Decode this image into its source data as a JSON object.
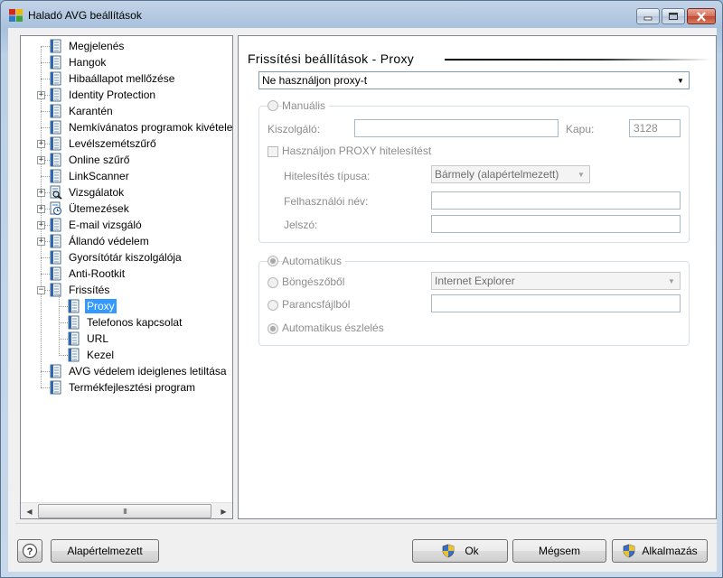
{
  "window": {
    "title": "Haladó AVG beállítások"
  },
  "tree": {
    "items": [
      {
        "label": "Megjelenés",
        "expandable": false,
        "level": 0,
        "icon": "settings-page-icon"
      },
      {
        "label": "Hangok",
        "expandable": false,
        "level": 0,
        "icon": "settings-page-icon"
      },
      {
        "label": "Hibaállapot mellőzése",
        "expandable": false,
        "level": 0,
        "icon": "settings-page-icon"
      },
      {
        "label": "Identity Protection",
        "expandable": true,
        "level": 0,
        "icon": "settings-page-icon"
      },
      {
        "label": "Karantén",
        "expandable": false,
        "level": 0,
        "icon": "settings-page-icon"
      },
      {
        "label": "Nemkívánatos programok kivételei",
        "expandable": false,
        "level": 0,
        "icon": "settings-page-icon"
      },
      {
        "label": "Levélszemétszűrő",
        "expandable": true,
        "level": 0,
        "icon": "settings-page-icon"
      },
      {
        "label": "Online szűrő",
        "expandable": true,
        "level": 0,
        "icon": "settings-page-icon"
      },
      {
        "label": "LinkScanner",
        "expandable": false,
        "level": 0,
        "icon": "settings-page-icon"
      },
      {
        "label": "Vizsgálatok",
        "expandable": true,
        "level": 0,
        "icon": "scan-magnifier-icon"
      },
      {
        "label": "Ütemezések",
        "expandable": true,
        "level": 0,
        "icon": "schedule-clock-icon"
      },
      {
        "label": "E-mail vizsgáló",
        "expandable": true,
        "level": 0,
        "icon": "settings-page-icon"
      },
      {
        "label": "Állandó védelem",
        "expandable": true,
        "level": 0,
        "icon": "settings-page-icon"
      },
      {
        "label": "Gyorsítótár kiszolgálója",
        "expandable": false,
        "level": 0,
        "icon": "settings-page-icon"
      },
      {
        "label": "Anti-Rootkit",
        "expandable": false,
        "level": 0,
        "icon": "settings-page-icon"
      },
      {
        "label": "Frissítés",
        "expandable": true,
        "expanded": true,
        "level": 0,
        "icon": "settings-page-icon"
      },
      {
        "label": "Proxy",
        "expandable": false,
        "level": 1,
        "icon": "settings-page-icon",
        "selected": true
      },
      {
        "label": "Telefonos kapcsolat",
        "expandable": false,
        "level": 1,
        "icon": "settings-page-icon"
      },
      {
        "label": "URL",
        "expandable": false,
        "level": 1,
        "icon": "settings-page-icon"
      },
      {
        "label": "Kezel",
        "expandable": false,
        "level": 1,
        "icon": "settings-page-icon"
      },
      {
        "label": "AVG védelem ideiglenes letiltása",
        "expandable": false,
        "level": 0,
        "icon": "settings-page-icon"
      },
      {
        "label": "Termékfejlesztési program",
        "expandable": false,
        "level": 0,
        "icon": "settings-page-icon"
      }
    ],
    "scroll_grip": "III"
  },
  "panel": {
    "title": "Frissítési beállítások - Proxy",
    "proxy_mode": "Ne használjon proxy-t",
    "manual": {
      "radio_label": "Manuális",
      "server_label": "Kiszolgáló:",
      "server_value": "",
      "port_label": "Kapu:",
      "port_value": "3128",
      "use_auth_label": "Használjon PROXY hitelesítést",
      "auth_type_label": "Hitelesítés típusa:",
      "auth_type_value": "Bármely (alapértelmezett)",
      "username_label": "Felhasználói név:",
      "username_value": "",
      "password_label": "Jelszó:",
      "password_value": ""
    },
    "automatic": {
      "radio_label": "Automatikus",
      "browser_label": "Böngészőből",
      "browser_value": "Internet Explorer",
      "script_label": "Parancsfájlból",
      "script_value": "",
      "detect_label": "Automatikus észlelés"
    }
  },
  "footer": {
    "help_icon": "help-question-icon",
    "defaults_label": "Alapértelmezett",
    "ok_label": "Ok",
    "cancel_label": "Mégsem",
    "apply_label": "Alkalmazás"
  },
  "colors": {
    "selection": "#3399ff",
    "window_frame": "#a9c1dd",
    "client_bg": "#f0f0f0"
  }
}
